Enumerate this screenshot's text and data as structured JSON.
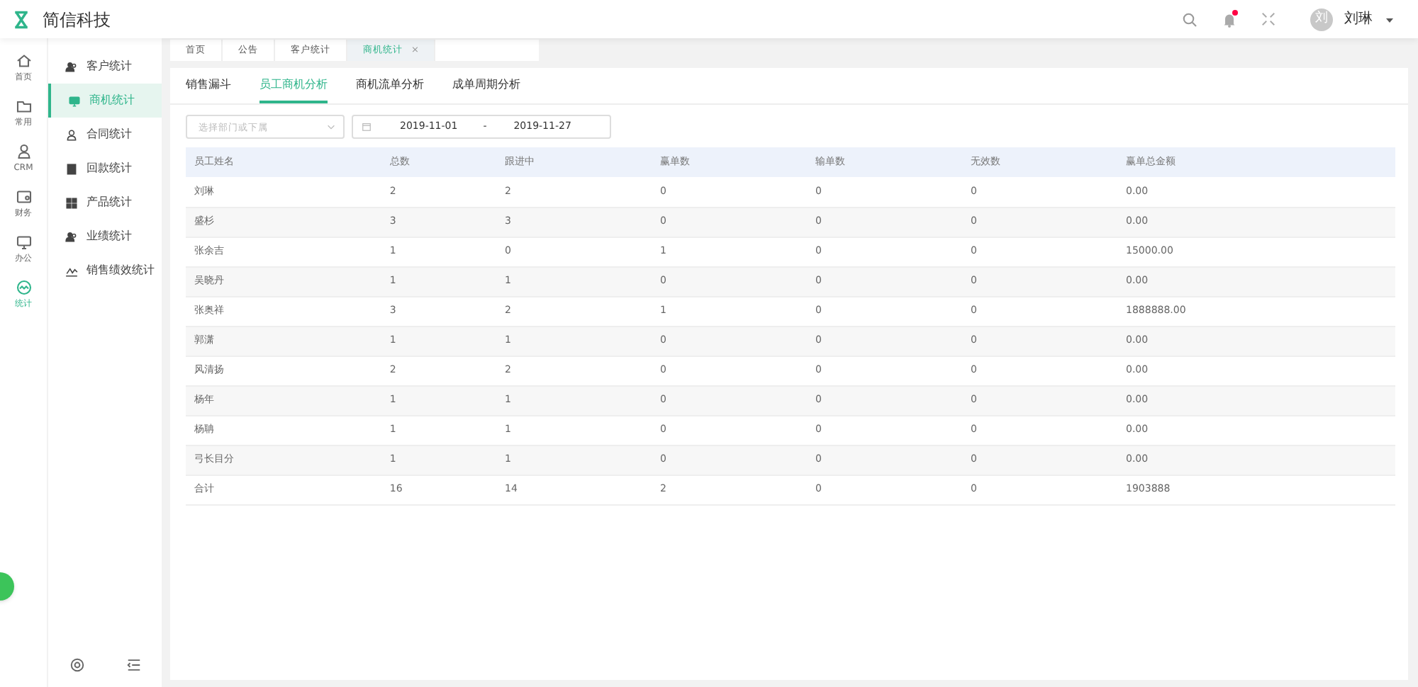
{
  "app": {
    "title": "简信科技"
  },
  "header": {
    "notification_badge": true,
    "user": {
      "avatar": "刘",
      "name": "刘琳"
    }
  },
  "rail": [
    {
      "label": "首页",
      "selected": false
    },
    {
      "label": "常用",
      "selected": false
    },
    {
      "label": "CRM",
      "selected": false
    },
    {
      "label": "财务",
      "selected": false
    },
    {
      "label": "办公",
      "selected": false
    },
    {
      "label": "统计",
      "selected": true
    }
  ],
  "sidebar": {
    "items": [
      {
        "label": "客户统计",
        "selected": false
      },
      {
        "label": "商机统计",
        "selected": true
      },
      {
        "label": "合同统计",
        "selected": false
      },
      {
        "label": "回款统计",
        "selected": false
      },
      {
        "label": "产品统计",
        "selected": false
      },
      {
        "label": "业绩统计",
        "selected": false
      },
      {
        "label": "销售绩效统计",
        "selected": false
      }
    ]
  },
  "page_tabs": [
    {
      "label": "首页",
      "selected": false
    },
    {
      "label": "公告",
      "selected": false
    },
    {
      "label": "客户统计",
      "selected": false
    },
    {
      "label": "商机统计",
      "selected": true,
      "close": "×"
    }
  ],
  "tabs": [
    {
      "label": "销售漏斗",
      "selected": false
    },
    {
      "label": "员工商机分析",
      "selected": true
    },
    {
      "label": "商机流单分析",
      "selected": false
    },
    {
      "label": "成单周期分析",
      "selected": false
    }
  ],
  "filters": {
    "department": {
      "placeholder": "选择部门或下属"
    },
    "date_start": "2019-11-01",
    "date_separator": "-",
    "date_end": "2019-11-27"
  },
  "table": {
    "columns": [
      "员工姓名",
      "总数",
      "跟进中",
      "赢单数",
      "输单数",
      "无效数",
      "赢单总金额"
    ],
    "rows": [
      [
        "刘琳",
        "2",
        "2",
        "0",
        "0",
        "0",
        "0.00"
      ],
      [
        "盛杉",
        "3",
        "3",
        "0",
        "0",
        "0",
        "0.00"
      ],
      [
        "张余吉",
        "1",
        "0",
        "1",
        "0",
        "0",
        "15000.00"
      ],
      [
        "吴晓丹",
        "1",
        "1",
        "0",
        "0",
        "0",
        "0.00"
      ],
      [
        "张奥祥",
        "3",
        "2",
        "1",
        "0",
        "0",
        "1888888.00"
      ],
      [
        "郭潇",
        "1",
        "1",
        "0",
        "0",
        "0",
        "0.00"
      ],
      [
        "风清扬",
        "2",
        "2",
        "0",
        "0",
        "0",
        "0.00"
      ],
      [
        "杨年",
        "1",
        "1",
        "0",
        "0",
        "0",
        "0.00"
      ],
      [
        "杨聃",
        "1",
        "1",
        "0",
        "0",
        "0",
        "0.00"
      ],
      [
        "弓长目分",
        "1",
        "1",
        "0",
        "0",
        "0",
        "0.00"
      ],
      [
        "合计",
        "16",
        "14",
        "2",
        "0",
        "0",
        "1903888"
      ]
    ]
  }
}
